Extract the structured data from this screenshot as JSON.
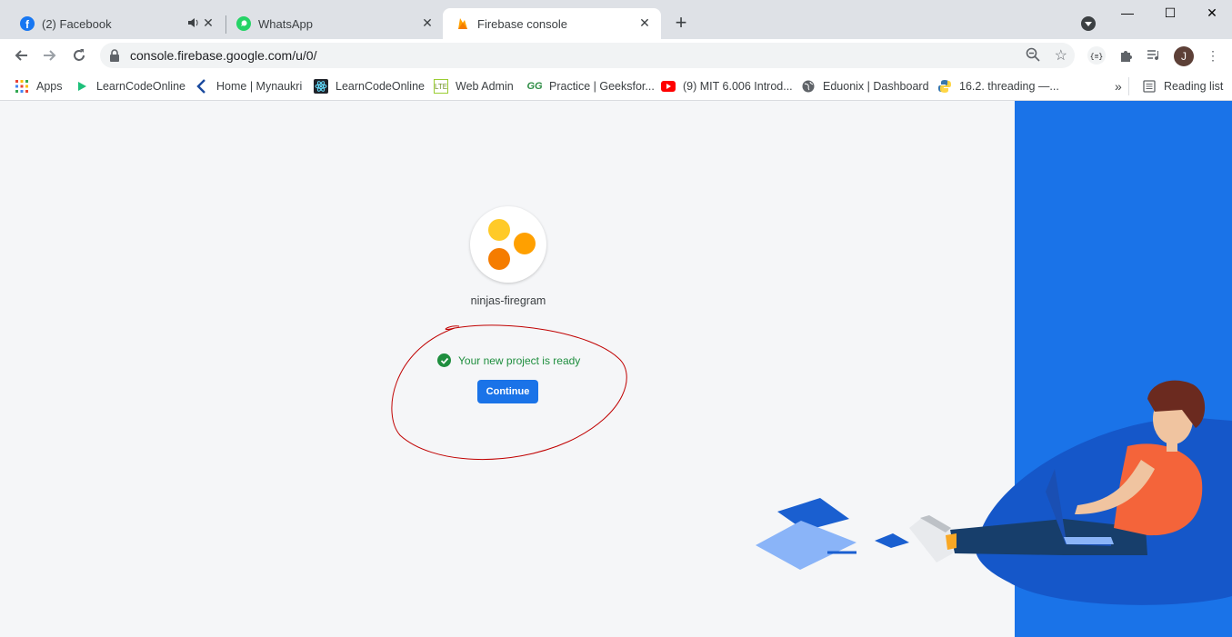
{
  "tabs": [
    {
      "title": "(2) Facebook",
      "icon": "facebook-icon",
      "audio": true
    },
    {
      "title": "WhatsApp",
      "icon": "whatsapp-icon"
    },
    {
      "title": "Firebase console",
      "icon": "firebase-icon",
      "active": true
    }
  ],
  "address": {
    "url": "console.firebase.google.com/u/0/"
  },
  "profile": {
    "initial": "J"
  },
  "bookmarks": [
    {
      "label": "Apps",
      "icon": "apps-grid-icon"
    },
    {
      "label": "LearnCodeOnline",
      "icon": "play-triangle-icon"
    },
    {
      "label": "Home | Mynaukri",
      "icon": "mynaukri-icon"
    },
    {
      "label": "LearnCodeOnline",
      "icon": "react-atom-icon"
    },
    {
      "label": "Web Admin",
      "icon": "lte-icon"
    },
    {
      "label": "Practice | Geeksfor...",
      "icon": "geeksforgeeks-icon"
    },
    {
      "label": "(9) MIT 6.006 Introd...",
      "icon": "youtube-icon"
    },
    {
      "label": "Eduonix | Dashboard",
      "icon": "globe-icon"
    },
    {
      "label": "16.2. threading —...",
      "icon": "python-icon"
    }
  ],
  "reading_list": "Reading list",
  "project": {
    "name": "ninjas-firegram",
    "status": "Your new project is ready",
    "continue_label": "Continue"
  },
  "colors": {
    "accent": "#1a73e8",
    "success": "#1e8e3e",
    "annotation": "#c00000"
  }
}
